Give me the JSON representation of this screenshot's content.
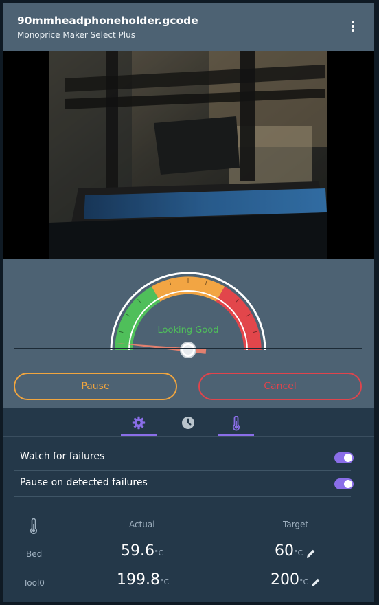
{
  "header": {
    "title": "90mmheadphoneholder.gcode",
    "subtitle": "Monoprice Maker Select Plus",
    "menu_icon": "kebab-menu-icon"
  },
  "gauge": {
    "status_text": "Looking Good",
    "status_color": "#4fbf5a",
    "zones": [
      {
        "name": "good",
        "color": "#4fbf5a"
      },
      {
        "name": "warning",
        "color": "#f2a543"
      },
      {
        "name": "failure",
        "color": "#e2464b"
      }
    ],
    "level_fraction": 0.03
  },
  "actions": {
    "pause_label": "Pause",
    "cancel_label": "Cancel",
    "pause_color": "#f0a53f",
    "cancel_color": "#e0444c"
  },
  "tabs": [
    {
      "name": "settings",
      "icon": "gear-icon",
      "active": true
    },
    {
      "name": "time",
      "icon": "clock-icon",
      "active": false
    },
    {
      "name": "temperature",
      "icon": "thermometer-icon",
      "active": true
    }
  ],
  "settings": {
    "watch_label": "Watch for failures",
    "watch_enabled": true,
    "pause_on_failure_label": "Pause on detected failures",
    "pause_on_failure_enabled": true
  },
  "temperatures": {
    "actual_header": "Actual",
    "target_header": "Target",
    "unit": "°C",
    "rows": [
      {
        "name": "Bed",
        "actual": "59.6",
        "target": "60"
      },
      {
        "name": "Tool0",
        "actual": "199.8",
        "target": "200"
      }
    ]
  },
  "colors": {
    "accent": "#8a6ee8",
    "panel": "#4d6273",
    "background": "#243849"
  }
}
